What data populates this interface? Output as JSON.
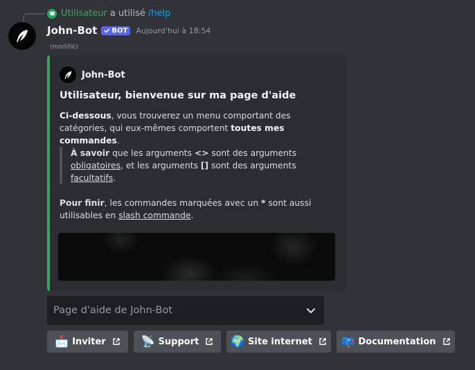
{
  "reply": {
    "user": "Utilisateur",
    "verb": "a utilisé",
    "command": "/help"
  },
  "message": {
    "author": "John-Bot",
    "bot_tag": "BOT",
    "timestamp": "Aujourd'hui à 18:54",
    "edited": "(modifié)"
  },
  "embed": {
    "accent_color": "#3ba55c",
    "author_name": "John-Bot",
    "title": "Utilisateur, bienvenue sur ma page d'aide",
    "desc_bold_start": "Ci-dessous",
    "desc_mid": ", vous trouverez un menu comportant des catégories, qui eux-mêmes comportent ",
    "desc_bold_end": "toutes mes commandes",
    "desc_end": ".",
    "quote": {
      "bold_start": "À savoir",
      "t1": " que les arguments ",
      "sym1": "<>",
      "t2": " sont des arguments ",
      "u1": "obligatoires",
      "t3": ", et les arguments ",
      "sym2": "[]",
      "t4": " sont des arguments ",
      "u2": "facultatifs",
      "t5": "."
    },
    "finish": {
      "bold_start": "Pour finir",
      "t1": ", les commandes marquées avec un ",
      "star": "*",
      "t2": " sont aussi utilisables en ",
      "u1": "slash commande",
      "t3": "."
    }
  },
  "select": {
    "placeholder": "Page d'aide de John-Bot"
  },
  "buttons": [
    {
      "icon": "envelope-icon",
      "emoji": "📩",
      "label": "Inviter"
    },
    {
      "icon": "satellite-icon",
      "emoji": "📡",
      "label": "Support"
    },
    {
      "icon": "globe-icon",
      "emoji": "🌍",
      "label": "Site internet"
    },
    {
      "icon": "mailbox-icon",
      "emoji": "📪",
      "label": "Documentation"
    }
  ]
}
